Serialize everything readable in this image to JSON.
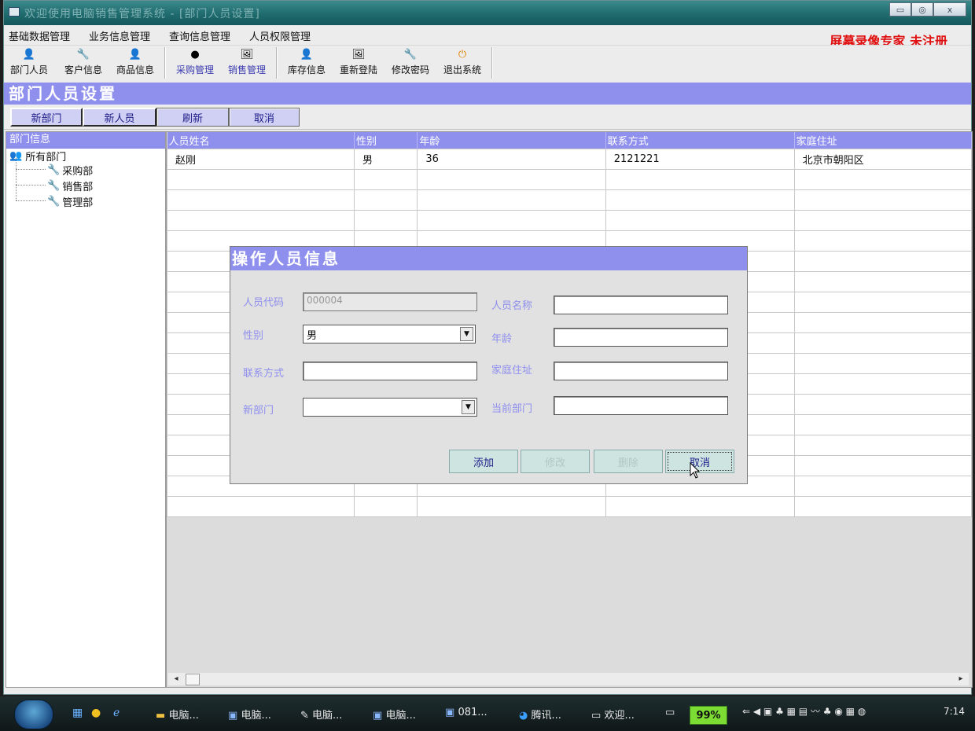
{
  "window": {
    "title": "欢迎使用电脑销售管理系统 - [部门人员设置]",
    "controls": {
      "minimize": "▭",
      "restore": "◎",
      "close": "ⅹ"
    }
  },
  "menubar": {
    "items": [
      "基础数据管理",
      "业务信息管理",
      "查询信息管理",
      "人员权限管理"
    ],
    "watermark": "屏幕录像专家  未注册"
  },
  "toolbar": {
    "items": [
      {
        "label": "部门人员",
        "icon": "user-icon"
      },
      {
        "label": "客户信息",
        "icon": "tool-icon"
      },
      {
        "label": "商品信息",
        "icon": "user-icon"
      },
      {
        "label": "采购管理",
        "icon": "circle-icon"
      },
      {
        "label": "销售管理",
        "icon": "picture-icon"
      },
      {
        "label": "库存信息",
        "icon": "user-icon"
      },
      {
        "label": "重新登陆",
        "icon": "picture-icon"
      },
      {
        "label": "修改密码",
        "icon": "tool-icon"
      },
      {
        "label": "退出系统",
        "icon": "power-icon"
      }
    ]
  },
  "form": {
    "title": "部门人员设置",
    "buttons": [
      "新部门",
      "新人员",
      "刷新",
      "取消"
    ]
  },
  "dept_panel": {
    "header": "部门信息",
    "root": "所有部门",
    "children": [
      "采购部",
      "销售部",
      "管理部"
    ]
  },
  "grid": {
    "columns": [
      "人员姓名",
      "性别",
      "年龄",
      "联系方式",
      "家庭住址"
    ],
    "rows": [
      [
        "赵刚",
        "男",
        "36",
        "2121221",
        "北京市朝阳区"
      ]
    ]
  },
  "dialog": {
    "title": "操作人员信息",
    "labels": {
      "code": "人员代码",
      "name": "人员名称",
      "gender": "性别",
      "age": "年龄",
      "contact": "联系方式",
      "address": "家庭住址",
      "new_dept": "新部门",
      "current_dept": "当前部门"
    },
    "values": {
      "code": "000004",
      "name": "",
      "gender": "男",
      "age": "",
      "contact": "",
      "address": "",
      "new_dept": "",
      "current_dept": ""
    },
    "buttons": {
      "add": "添加",
      "edit": "修改",
      "delete": "删除",
      "cancel": "取消"
    }
  },
  "taskbar": {
    "tasks": [
      "电脑...",
      "电脑...",
      "电脑...",
      "电脑...",
      "081...",
      "腾讯...",
      "欢迎..."
    ],
    "battery": "99%",
    "clock": "7:14"
  },
  "colors": {
    "title_band": "#8f8fee",
    "titlebar": "#1f6b6e",
    "watermark": "#e01010",
    "button_face": "#cde4e0"
  }
}
